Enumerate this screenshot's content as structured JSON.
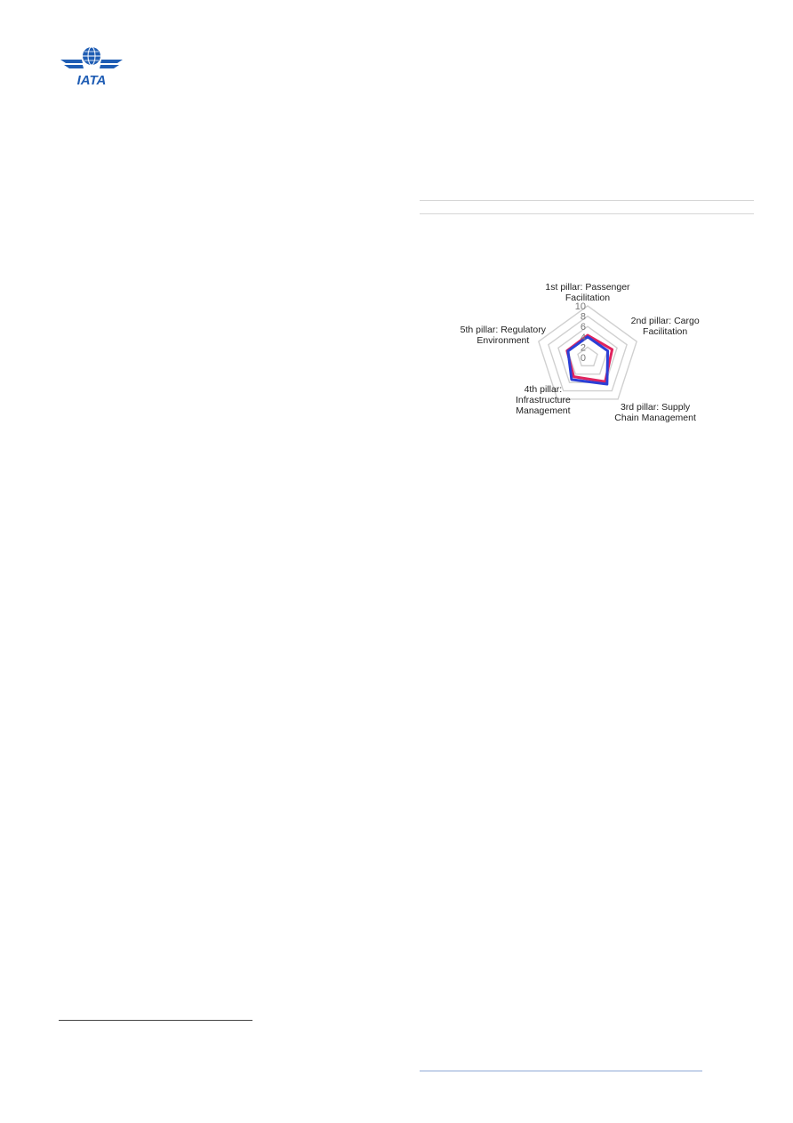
{
  "logo": {
    "text": "IATA",
    "icon": "iata-globe-wings-logo",
    "color": "#1f5db4"
  },
  "chart_data": {
    "type": "radar",
    "axes": [
      [
        "1st pillar: Passenger",
        "Facilitation"
      ],
      [
        "2nd pillar: Cargo",
        "Facilitation"
      ],
      [
        "3rd pillar: Supply",
        "Chain Management"
      ],
      [
        "4th pillar:",
        "Infrastructure",
        "Management"
      ],
      [
        "5th pillar: Regulatory",
        "Environment"
      ]
    ],
    "rlim": [
      0,
      10
    ],
    "ticks": [
      "0",
      "2",
      "4",
      "6",
      "8",
      "10"
    ],
    "grid": true,
    "series": [
      {
        "color": "#e0245e",
        "values": [
          4.3,
          5.0,
          5.8,
          4.6,
          4.2
        ]
      },
      {
        "color": "#2b3fd6",
        "values": [
          4.0,
          4.1,
          6.4,
          5.3,
          4.0
        ]
      }
    ],
    "grid_color": "#d0d0d0",
    "tick_color": "#777777",
    "label_color": "#222222"
  }
}
